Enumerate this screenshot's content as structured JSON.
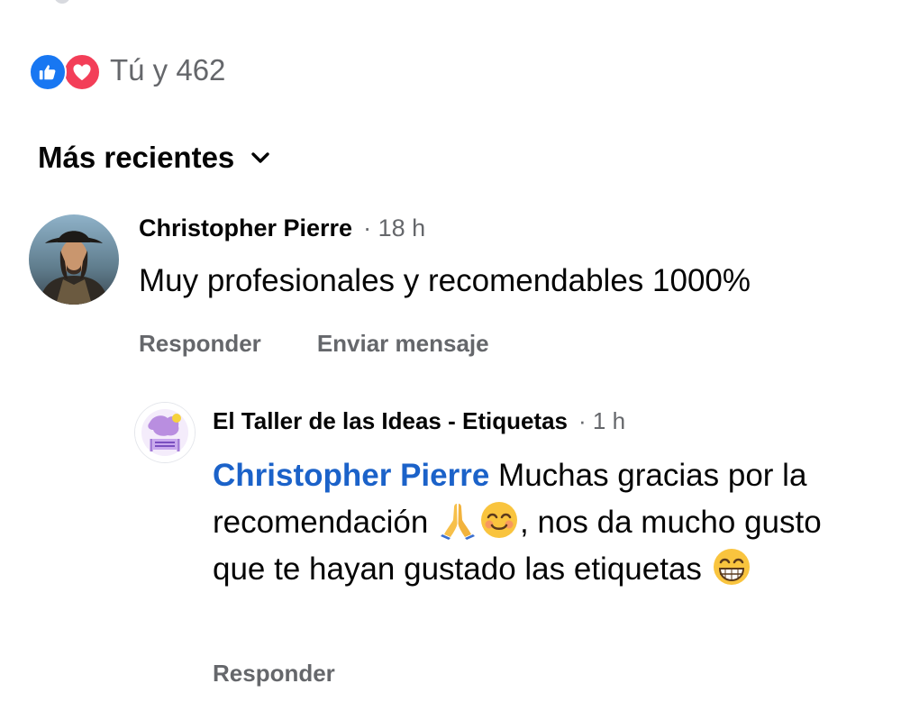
{
  "reactions": {
    "icons": [
      "like-icon",
      "love-icon"
    ],
    "summary": "Tú y 462"
  },
  "sort": {
    "label": "Más recientes",
    "icon": "chevron-down-icon"
  },
  "comments": [
    {
      "author": "Christopher Pierre",
      "time": "· 18 h",
      "text": "Muy profesionales y recomendables 1000%",
      "actions": [
        "Responder",
        "Enviar mensaje"
      ],
      "replies": [
        {
          "author": "El Taller de las Ideas - Etiquetas",
          "time": "· 1 h",
          "mention": "Christopher Pierre",
          "segments": [
            " Muchas gracias por la recomendación ",
            ", nos da mucho gusto que te hayan gustado las etiquetas "
          ],
          "emojis": [
            "folded-hands-emoji",
            "smiling-face-emoji",
            "grinning-face-emoji"
          ],
          "actions": [
            "Responder"
          ]
        }
      ]
    }
  ],
  "colors": {
    "like": "#1877f2",
    "love": "#f33e58",
    "mention": "#1b62c9",
    "secondary_text": "#65676b"
  }
}
